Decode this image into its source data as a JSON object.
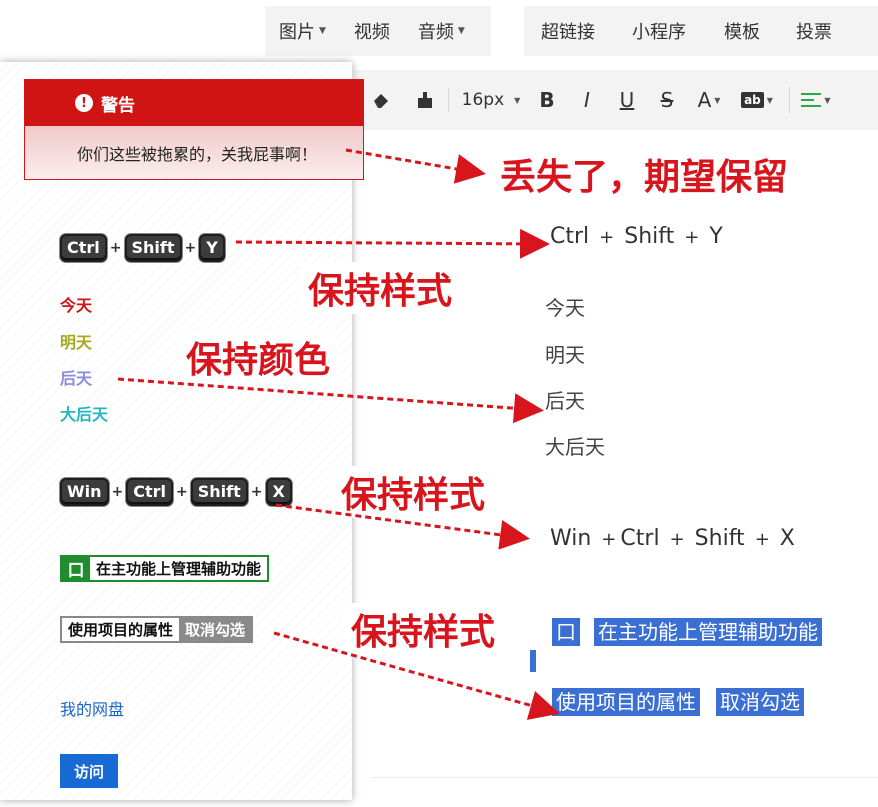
{
  "top_tabs": {
    "group1": [
      {
        "label": "图片",
        "has_caret": true
      },
      {
        "label": "视频",
        "has_caret": false
      },
      {
        "label": "音频",
        "has_caret": true
      }
    ],
    "group2": [
      {
        "label": "超链接"
      },
      {
        "label": "小程序"
      },
      {
        "label": "模板"
      },
      {
        "label": "投票"
      }
    ]
  },
  "toolbar": {
    "eraser_icon": "eraser-icon",
    "format_painter_icon": "format-painter-icon",
    "font_size": "16px",
    "bold": "B",
    "italic": "I",
    "underline": "U",
    "strike": "S",
    "font_color": "A",
    "highlight": "ab",
    "align_icon": "align-left-icon"
  },
  "panel": {
    "alert_title": "警告",
    "alert_icon": "!",
    "alert_text": "你们这些被拖累的，关我屁事啊！",
    "keys1": [
      "Ctrl",
      "Shift",
      "Y"
    ],
    "days": [
      {
        "label": "今天",
        "color": "#d01313"
      },
      {
        "label": "明天",
        "color": "#a8a820"
      },
      {
        "label": "后天",
        "color": "#8a8ae0"
      },
      {
        "label": "大后天",
        "color": "#24b6c4"
      }
    ],
    "keys2": [
      "Win",
      "Ctrl",
      "Shift",
      "X"
    ],
    "green_tag_box": "口",
    "green_tag_text": "在主功能上管理辅助功能",
    "gray_tag_a": "使用项目的属性",
    "gray_tag_b": "取消勾选",
    "link_text": "我的网盘",
    "visit_button": "访问"
  },
  "editor": {
    "keys1_text": [
      "Ctrl",
      "Shift",
      "Y"
    ],
    "plus": "+",
    "days": [
      "今天",
      "明天",
      "后天",
      "大后天"
    ],
    "keys2_text": [
      "Win",
      "Ctrl",
      "Shift",
      "X"
    ],
    "sel_box": "口",
    "sel_text1": "在主功能上管理辅助功能",
    "sel_text2a": "使用项目的属性",
    "sel_text2b": "取消勾选"
  },
  "annotations": {
    "lost": "丢失了，期望保留",
    "keep_style_1": "保持样式",
    "keep_color": "保持颜色",
    "keep_style_2": "保持样式",
    "keep_style_3": "保持样式",
    "color": "#d8141c"
  }
}
